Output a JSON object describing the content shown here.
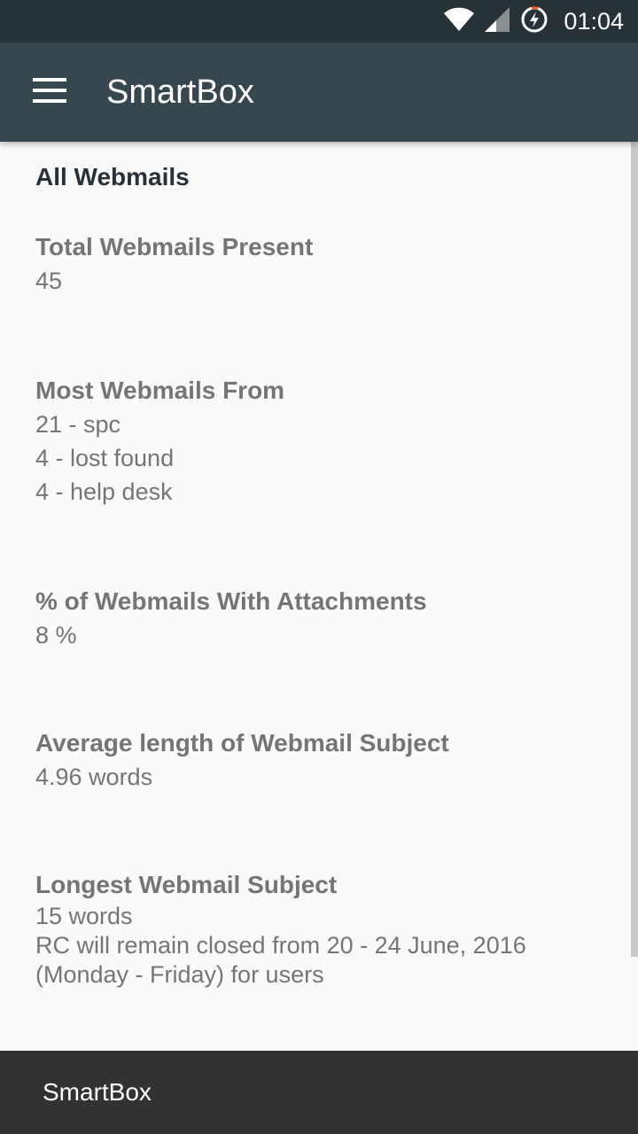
{
  "status_bar": {
    "time": "01:04",
    "icons": [
      "wifi-icon",
      "cell-signal-icon",
      "battery-saver-icon"
    ]
  },
  "app_bar": {
    "title": "SmartBox",
    "menu_icon": "hamburger-menu-icon"
  },
  "main": {
    "section_title": "All Webmails",
    "stats": [
      {
        "label": "Total Webmails Present",
        "lines": [
          "45"
        ]
      },
      {
        "label": "Most Webmails From",
        "lines": [
          "21 - spc",
          "4 - lost found",
          "4 - help desk"
        ]
      },
      {
        "label": "% of Webmails With Attachments",
        "lines": [
          "8 %"
        ]
      },
      {
        "label": "Average length of Webmail Subject",
        "lines": [
          "4.96 words"
        ]
      },
      {
        "label": "Longest Webmail Subject",
        "lines": [
          "15 words",
          "RC will remain closed from 20 - 24 June, 2016",
          "(Monday - Friday) for users"
        ]
      }
    ]
  },
  "bottom_bar": {
    "title": "SmartBox"
  },
  "colors": {
    "status_bar": "#263238",
    "app_bar": "#37474f",
    "background": "#fafafa",
    "bottom_bar": "#323232",
    "label_text": "#757575",
    "heading_text": "#263238"
  }
}
